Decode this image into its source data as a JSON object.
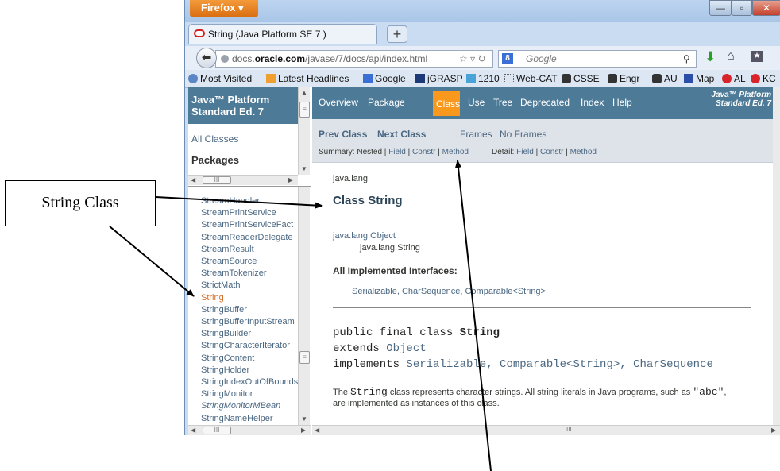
{
  "browser": {
    "app_menu_label": "Firefox",
    "tab_title": "String (Java Platform SE 7 )",
    "new_tab_label": "+",
    "url_prefix": "docs.",
    "url_domain": "oracle.com",
    "url_path": "/javase/7/docs/api/index.html",
    "search_placeholder": "Google",
    "bookmarks": [
      "Most Visited",
      "Latest Headlines",
      "Google",
      "jGRASP",
      "1210",
      "Web-CAT",
      "CSSE",
      "Engr",
      "AU",
      "Map",
      "AL",
      "KC"
    ]
  },
  "javadoc": {
    "platform_title": "Java™ Platform Standard Ed. 7",
    "all_classes": "All Classes",
    "packages": "Packages",
    "class_list": [
      "StreamHandler",
      "StreamPrintService",
      "StreamPrintServiceFact",
      "StreamReaderDelegate",
      "StreamResult",
      "StreamSource",
      "StreamTokenizer",
      "StrictMath",
      "String",
      "StringBuffer",
      "StringBufferInputStream",
      "StringBuilder",
      "StringCharacterIterator",
      "StringContent",
      "StringHolder",
      "StringIndexOutOfBounds",
      "StringMonitor",
      "StringMonitorMBean",
      "StringNameHelper"
    ],
    "selected_class": "String",
    "top_nav": [
      "Overview",
      "Package",
      "Class",
      "Use",
      "Tree",
      "Deprecated",
      "Index",
      "Help"
    ],
    "active_nav": "Class",
    "sub_nav": {
      "prev": "Prev Class",
      "next": "Next Class",
      "frames": "Frames",
      "no_frames": "No Frames",
      "summary_label": "Summary:",
      "summary_items": [
        "Nested",
        "Field",
        "Constr",
        "Method"
      ],
      "detail_label": "Detail:",
      "detail_items": [
        "Field",
        "Constr",
        "Method"
      ]
    },
    "package_name": "java.lang",
    "class_title": "Class String",
    "hierarchy": [
      "java.lang.Object",
      "java.lang.String"
    ],
    "implemented_heading": "All Implemented Interfaces:",
    "interfaces": "Serializable, CharSequence, Comparable<String>",
    "decl_line1_prefix": "public final class ",
    "decl_line1_name": "String",
    "decl_line2_kw": "extends ",
    "decl_line2_link": "Object",
    "decl_line3_kw": "implements ",
    "decl_line3_links": "Serializable, Comparable<String>, CharSequence",
    "desc_part1": "The ",
    "desc_code1": "String",
    "desc_part2": " class represents character strings. All string literals in Java programs, such as ",
    "desc_code2": "\"abc\"",
    "desc_part3": ",",
    "desc_line2": "are implemented as instances of this class."
  },
  "annotation": {
    "label": "String Class"
  },
  "colors": {
    "javadoc_header": "#4d7a97",
    "active_tab": "#f8981d",
    "link": "#4a6782",
    "selected_class": "#d46f2b"
  }
}
